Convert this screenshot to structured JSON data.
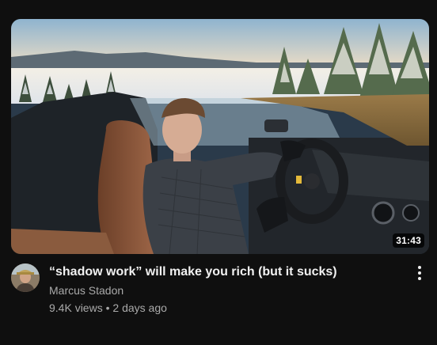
{
  "video": {
    "title": "“shadow work” will make you rich (but it sucks)",
    "channel": "Marcus Stadon",
    "views": "9.4K views",
    "separator": "•",
    "uploaded": "2 days ago",
    "duration": "31:43"
  },
  "icons": {
    "more": "vertical-ellipsis-icon"
  },
  "colors": {
    "background": "#0f0f0f",
    "title": "#f1f1f1",
    "secondary_text": "#aaaaaa",
    "badge_bg": "#000000"
  }
}
